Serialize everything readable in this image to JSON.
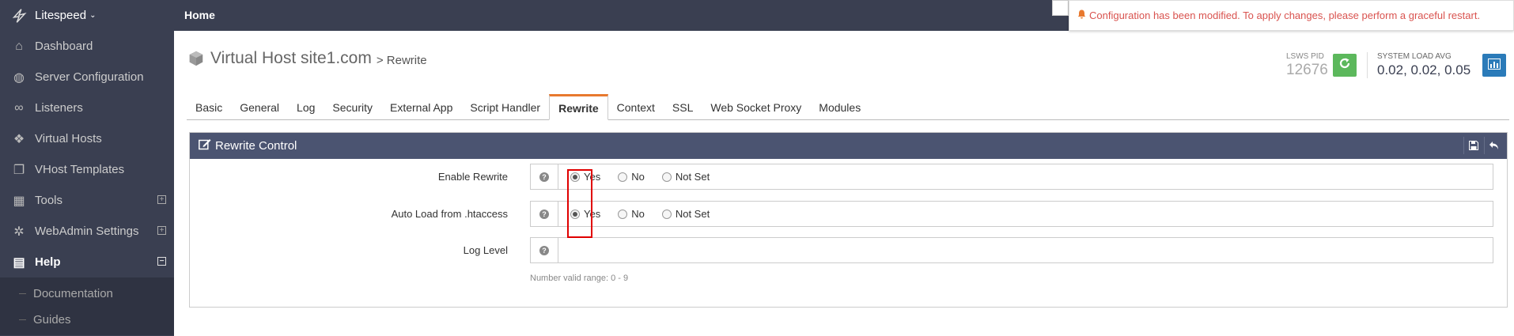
{
  "brand": {
    "name": "Litespeed",
    "caret": "⌄"
  },
  "sidebar": {
    "items": [
      {
        "label": "Dashboard",
        "icon": "home-icon",
        "glyph": "⌂"
      },
      {
        "label": "Server Configuration",
        "icon": "globe-icon",
        "glyph": "◍"
      },
      {
        "label": "Listeners",
        "icon": "link-icon",
        "glyph": "∞"
      },
      {
        "label": "Virtual Hosts",
        "icon": "cubes-icon",
        "glyph": "❖"
      },
      {
        "label": "VHost Templates",
        "icon": "copy-icon",
        "glyph": "❐"
      },
      {
        "label": "Tools",
        "icon": "grid-icon",
        "glyph": "▦",
        "expander": "+"
      },
      {
        "label": "WebAdmin Settings",
        "icon": "gear-icon",
        "glyph": "✲",
        "expander": "+"
      },
      {
        "label": "Help",
        "icon": "book-icon",
        "glyph": "▤",
        "expander": "−"
      }
    ],
    "sub_items": [
      {
        "label": "Documentation"
      },
      {
        "label": "Guides"
      }
    ]
  },
  "topbar": {
    "home": "Home",
    "notice": "Configuration has been modified. To apply changes, please perform a graceful restart."
  },
  "header": {
    "title": "Virtual Host site1.com",
    "subtitle": "> Rewrite",
    "pid_label": "LSWS PID",
    "pid_value": "12676",
    "load_label": "SYSTEM LOAD AVG",
    "load_value": "0.02, 0.02, 0.05"
  },
  "tabs": [
    {
      "label": "Basic"
    },
    {
      "label": "General"
    },
    {
      "label": "Log"
    },
    {
      "label": "Security"
    },
    {
      "label": "External App"
    },
    {
      "label": "Script Handler"
    },
    {
      "label": "Rewrite",
      "active": true
    },
    {
      "label": "Context"
    },
    {
      "label": "SSL"
    },
    {
      "label": "Web Socket Proxy"
    },
    {
      "label": "Modules"
    }
  ],
  "panel": {
    "title": "Rewrite Control",
    "rows": [
      {
        "label": "Enable Rewrite",
        "options": [
          "Yes",
          "No",
          "Not Set"
        ],
        "selected": "Yes"
      },
      {
        "label": "Auto Load from .htaccess",
        "options": [
          "Yes",
          "No",
          "Not Set"
        ],
        "selected": "Yes"
      },
      {
        "label": "Log Level",
        "value": ""
      }
    ],
    "hint": "Number valid range: 0 - 9"
  },
  "colors": {
    "sidebar_bg": "#3a3f51",
    "panel_head": "#4b5471",
    "active_tab_accent": "#e8792e",
    "notice_text": "#d9534f",
    "restart_green": "#5cb85c",
    "chart_blue": "#2b7bb9"
  }
}
